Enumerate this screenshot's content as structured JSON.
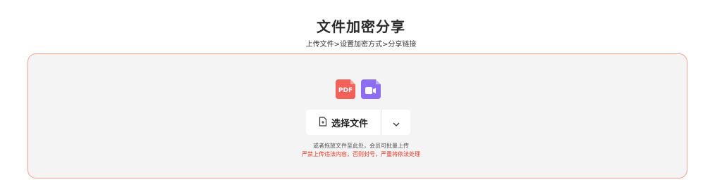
{
  "page": {
    "title": "文件加密分享",
    "steps": "上传文件>设置加密方式>分享链接"
  },
  "upload": {
    "file_types": [
      {
        "icon": "pdf-file-icon",
        "label": "PDF",
        "color": "#f2605a"
      },
      {
        "icon": "video-file-icon",
        "color": "#8d6df0"
      }
    ],
    "select_button_label": "选择文件",
    "dropdown_icon": "chevron-down-icon",
    "hint": "或者拖放文件至此处，会员可批量上传",
    "warning": "严禁上传违法内容，否则封号，严重将依法处理"
  },
  "colors": {
    "border": "#f3a28f",
    "dropzone_bg": "#f4f4f4",
    "warning": "#e8321b"
  }
}
